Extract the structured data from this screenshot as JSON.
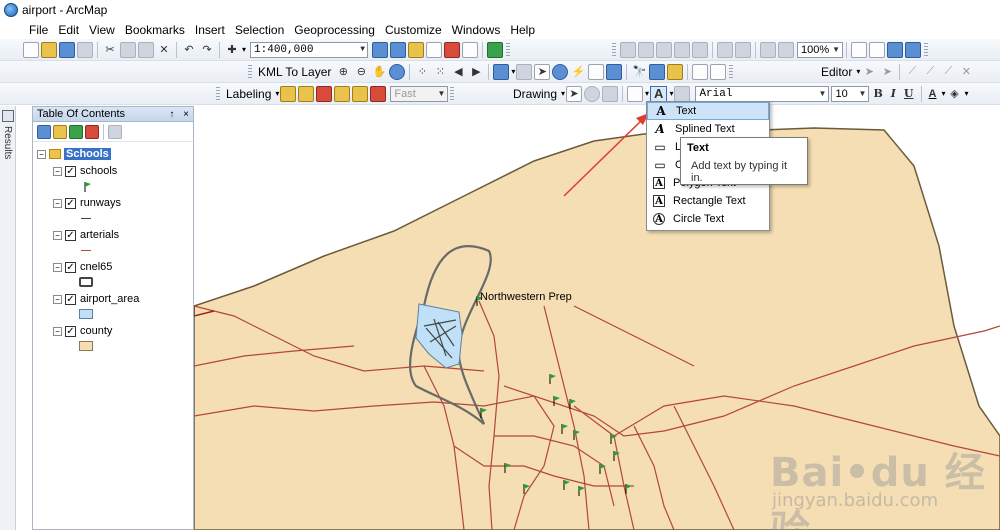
{
  "window": {
    "title": "airport - ArcMap"
  },
  "menu": [
    "File",
    "Edit",
    "View",
    "Bookmarks",
    "Insert",
    "Selection",
    "Geoprocessing",
    "Customize",
    "Windows",
    "Help"
  ],
  "toolbar": {
    "scale_value": "1:400,000",
    "zoom_value": "100%",
    "kml_label": "KML To Layer",
    "editor_label": "Editor",
    "labeling_label": "Labeling",
    "label_style_value": "Fast",
    "drawing_label": "Drawing",
    "font_name": "Arial",
    "font_size": "10",
    "bold_label": "B",
    "italic_label": "I",
    "underline_label": "U",
    "text_tool_label": "A"
  },
  "results_tab": {
    "label": "Results"
  },
  "toc": {
    "title": "Table Of Contents",
    "pin": "↑",
    "close": "×",
    "group": "Schools",
    "layers": [
      {
        "name": "schools",
        "symbol": "flag",
        "color": "#2f9e2f"
      },
      {
        "name": "runways",
        "symbol": "line",
        "color": "#444444"
      },
      {
        "name": "arterials",
        "symbol": "line",
        "color": "#b4463a"
      },
      {
        "name": "cnel65",
        "symbol": "box",
        "color": "#ffffff"
      },
      {
        "name": "airport_area",
        "symbol": "box",
        "color": "#bfe0f7"
      },
      {
        "name": "county",
        "symbol": "box",
        "color": "#f5deb3"
      }
    ]
  },
  "map": {
    "county_fill": "#f5deb3",
    "road_color": "#b4463a",
    "airport_fill": "#bfe0f7",
    "school_label": "Northwestern Prep"
  },
  "text_menu": {
    "items": [
      {
        "label": "Text",
        "icon": "A"
      },
      {
        "label": "Splined Text",
        "icon": "A"
      },
      {
        "label": "L",
        "icon": "▭"
      },
      {
        "label": "C",
        "icon": "▭"
      },
      {
        "label": "Polygon Text",
        "icon": "A"
      },
      {
        "label": "Rectangle Text",
        "icon": "A"
      },
      {
        "label": "Circle Text",
        "icon": "A"
      }
    ]
  },
  "tooltip": {
    "title": "Text",
    "body": "Add text by typing it in."
  },
  "watermark": {
    "main": "Bai•du 经验",
    "sub": "jingyan.baidu.com"
  }
}
